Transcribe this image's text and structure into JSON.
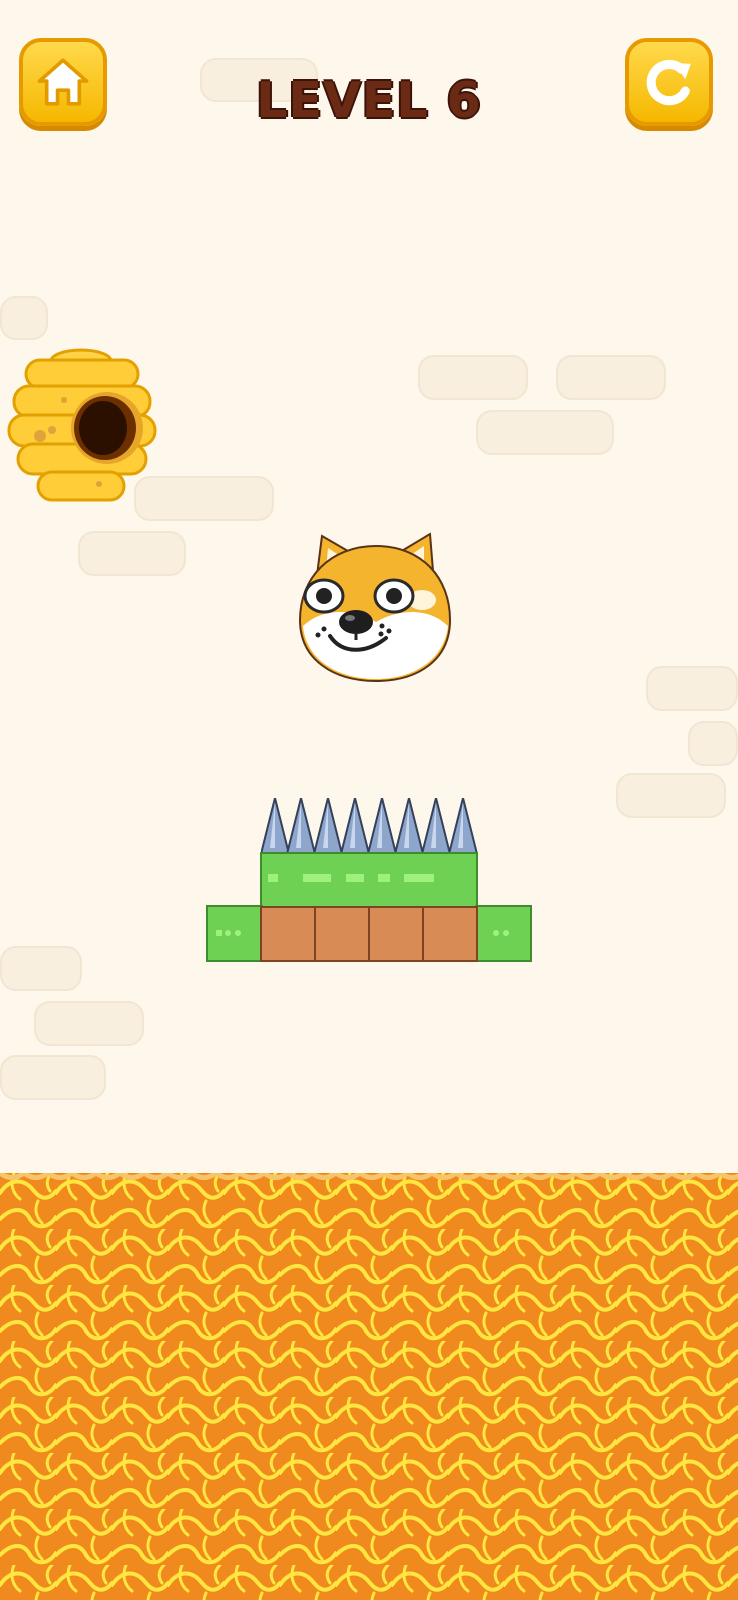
{
  "header": {
    "level_text": "LEVEL 6",
    "home_button_icon": "home-icon",
    "restart_button_icon": "restart-icon"
  },
  "scene": {
    "hive_icon": "beehive-icon",
    "character_icon": "shiba-dog-face-icon",
    "spikes_icon": "metal-spikes-icon",
    "platform_icon": "grass-dirt-platform-icon",
    "hazard_icon": "lava-pool-icon"
  },
  "colors": {
    "background": "#fdf7ec",
    "button": "#ffd94c",
    "title_text": "#6a2a14",
    "lava": "#f08a1f",
    "lava_cracks": "#ffe640",
    "grass": "#6fd153",
    "dirt": "#d98b55",
    "spikes": "#8fa6cc"
  }
}
